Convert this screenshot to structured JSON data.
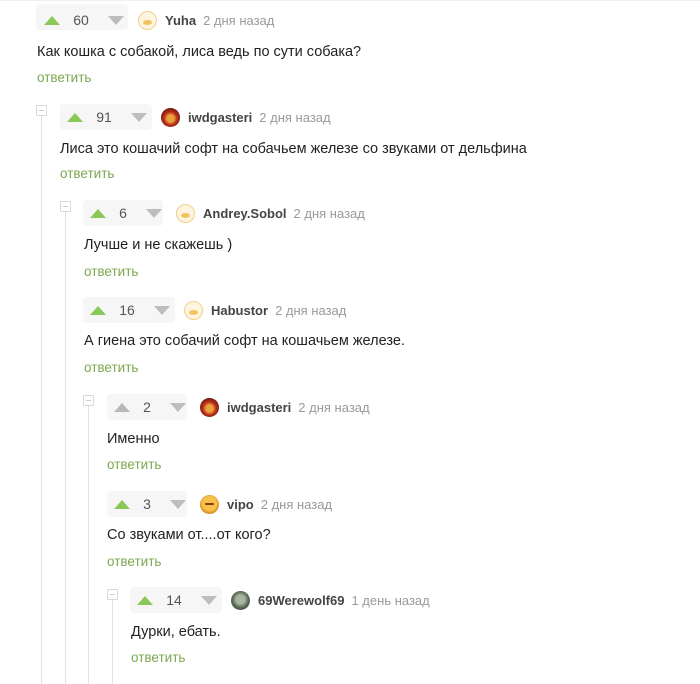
{
  "reply_label": "ответить",
  "colors": {
    "upvote": "#8ac858",
    "reply": "#7ca850",
    "time": "#9a9a9a",
    "thread_line": "#e2e2e2"
  },
  "comments": [
    {
      "score": "60",
      "username": "Yuha",
      "time": "2 дня назад",
      "text": "Как кошка с собакой, лиса ведь по сути собака?",
      "avatar": "yuha-avatar"
    },
    {
      "score": "91",
      "username": "iwdgasteri",
      "time": "2 дня назад",
      "text": "Лиса это кошачий софт на собачьем железе со звуками от дельфина",
      "avatar": "iwdgasteri-avatar"
    },
    {
      "score": "6",
      "username": "Andrey.Sobol",
      "time": "2 дня назад",
      "text": "Лучше и не скажешь )",
      "avatar": "andrey-sobol-avatar"
    },
    {
      "score": "16",
      "username": "Habustor",
      "time": "2 дня назад",
      "text": "А гиена это собачий софт на кошачьем железе.",
      "avatar": "habustor-avatar"
    },
    {
      "score": "2",
      "username": "iwdgasteri",
      "time": "2 дня назад",
      "text": "Именно",
      "avatar": "iwdgasteri-avatar"
    },
    {
      "score": "3",
      "username": "vipo",
      "time": "2 дня назад",
      "text": "Со звуками от....от кого?",
      "avatar": "vipo-avatar"
    },
    {
      "score": "14",
      "username": "69Werewolf69",
      "time": "1 день назад",
      "text": "Дурки, ебать.",
      "avatar": "werewolf-avatar"
    }
  ]
}
